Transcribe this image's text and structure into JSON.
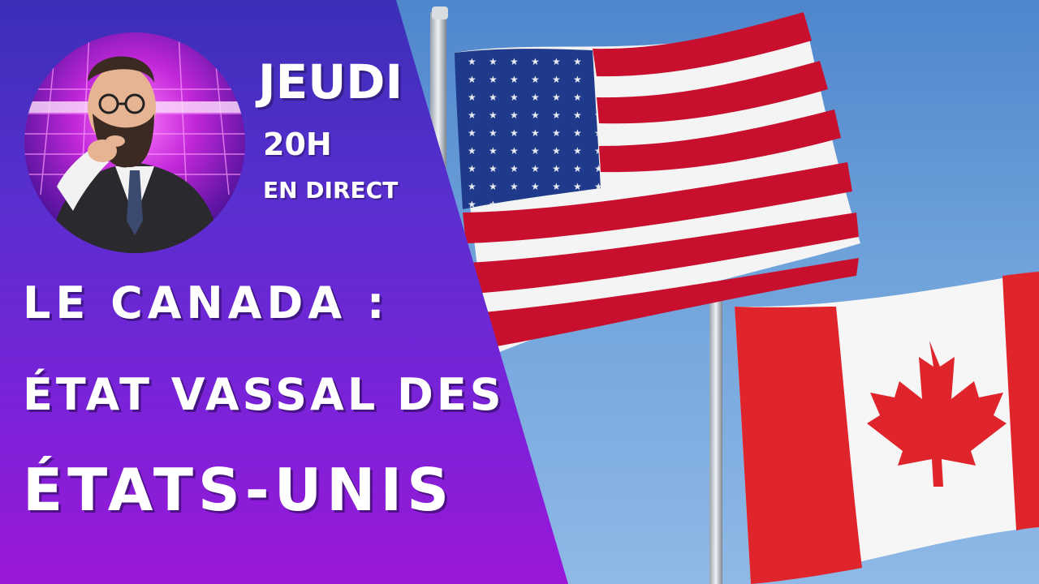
{
  "schedule": {
    "day": "JEUDI",
    "hour": "20H",
    "live": "EN DIRECT"
  },
  "headline": {
    "line1": "LE CANADA :",
    "line2": "ÉTAT VASSAL DES",
    "line3": "ÉTATS-UNIS"
  },
  "colors": {
    "panel_top": "#3b2fb8",
    "panel_bottom": "#9a17d8",
    "us_red": "#c8102e",
    "us_blue": "#1f3a8a",
    "canada_red": "#e0242b",
    "sky": "#6fa2db"
  },
  "icons": {
    "host_avatar": "pointing-man-avatar",
    "us_flag": "us-flag",
    "canada_flag": "canada-flag"
  }
}
